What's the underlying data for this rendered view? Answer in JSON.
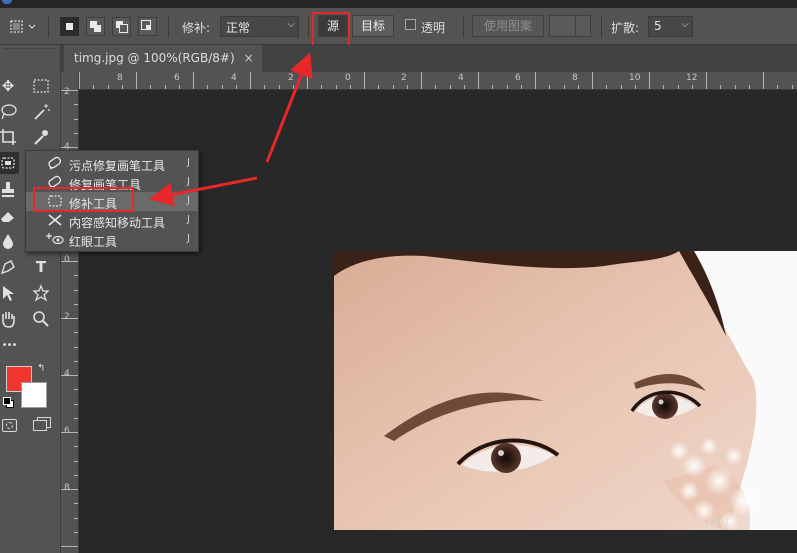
{
  "options_bar": {
    "patch_label": "修补:",
    "patch_mode": "正常",
    "source_button": "源",
    "target_button": "目标",
    "transparent_label": "透明",
    "use_pattern_button": "使用图案",
    "diffusion_label": "扩散:",
    "diffusion_value": "5"
  },
  "document": {
    "tab_title": "timg.jpg @ 100%(RGB/8#)",
    "close": "×"
  },
  "rulers": {
    "h_labels": [
      "8",
      "6",
      "4",
      "2",
      "0",
      "2",
      "4",
      "6",
      "8",
      "10",
      "12"
    ],
    "v_labels": [
      "2",
      "4",
      "0",
      "2",
      "4",
      "6",
      "8"
    ]
  },
  "toolbar": {
    "more": "•••",
    "type_tool": "T"
  },
  "flyout": {
    "items": [
      {
        "label": "污点修复画笔工具",
        "key": "J",
        "icon": "spot-healing-brush-icon"
      },
      {
        "label": "修复画笔工具",
        "key": "J",
        "icon": "healing-brush-icon"
      },
      {
        "label": "修补工具",
        "key": "J",
        "icon": "patch-icon"
      },
      {
        "label": "内容感知移动工具",
        "key": "J",
        "icon": "content-aware-move-icon"
      },
      {
        "label": "红眼工具",
        "key": "J",
        "icon": "red-eye-icon"
      }
    ]
  },
  "colors": {
    "foreground": "#f0352e",
    "background": "#ffffff",
    "highlight": "#e8272b"
  }
}
